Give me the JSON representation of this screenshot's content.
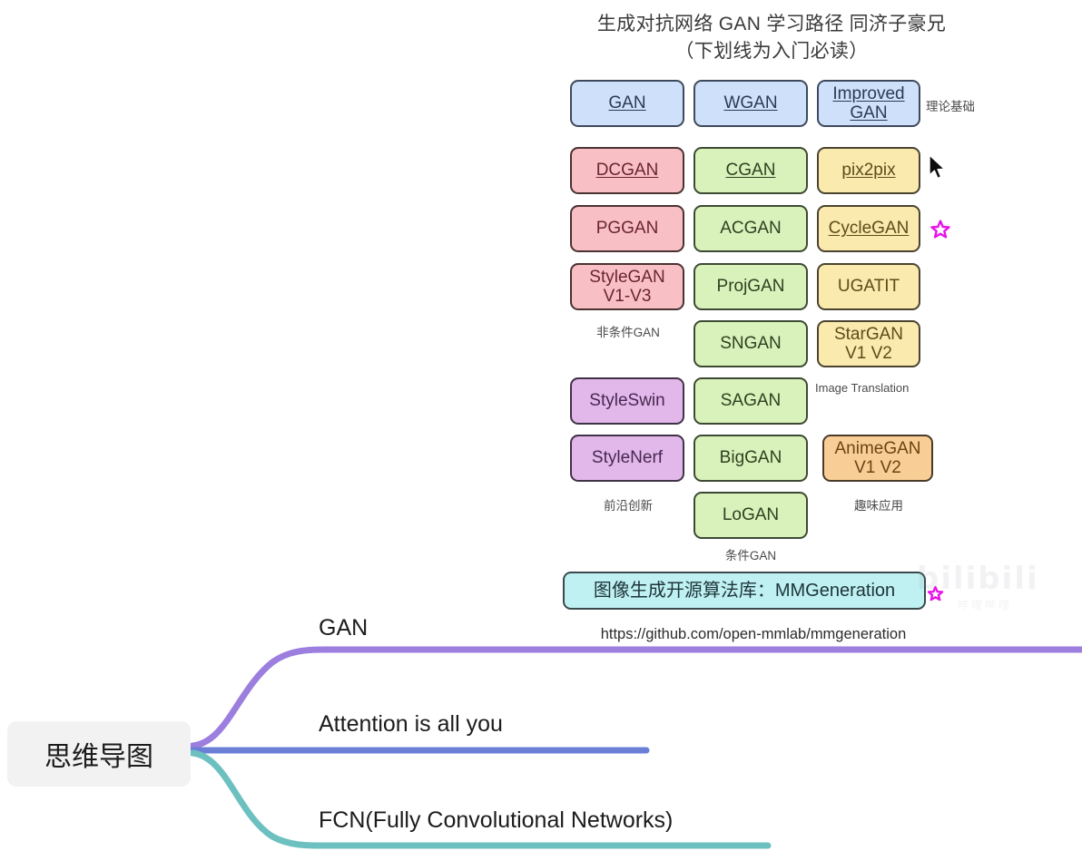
{
  "diagram": {
    "title_line1": "生成对抗网络 GAN 学习路径  同济子豪兄",
    "title_line2": "（下划线为入门必读）",
    "boxes": [
      {
        "label": "GAN",
        "color": "blue",
        "underline": true
      },
      {
        "label": "WGAN",
        "color": "blue",
        "underline": true
      },
      {
        "label": "Improved\nGAN",
        "color": "blue",
        "underline": true
      },
      {
        "label": "DCGAN",
        "color": "pink",
        "underline": true
      },
      {
        "label": "CGAN",
        "color": "green",
        "underline": true
      },
      {
        "label": "pix2pix",
        "color": "yellow",
        "underline": true
      },
      {
        "label": "PGGAN",
        "color": "pink",
        "underline": false
      },
      {
        "label": "ACGAN",
        "color": "green",
        "underline": false
      },
      {
        "label": "CycleGAN",
        "color": "yellow",
        "underline": true
      },
      {
        "label": "StyleGAN\nV1-V3",
        "color": "pink",
        "underline": false
      },
      {
        "label": "ProjGAN",
        "color": "green",
        "underline": false
      },
      {
        "label": "UGATIT",
        "color": "yellow",
        "underline": false
      },
      {
        "label": "SNGAN",
        "color": "green",
        "underline": false
      },
      {
        "label": "StarGAN\nV1 V2",
        "color": "yellow",
        "underline": false
      },
      {
        "label": "StyleSwin",
        "color": "purple",
        "underline": false
      },
      {
        "label": "SAGAN",
        "color": "green",
        "underline": false
      },
      {
        "label": "StyleNerf",
        "color": "purple",
        "underline": false
      },
      {
        "label": "BigGAN",
        "color": "green",
        "underline": false
      },
      {
        "label": "AnimeGAN\nV1 V2",
        "color": "orange",
        "underline": false
      },
      {
        "label": "LoGAN",
        "color": "green",
        "underline": false
      }
    ],
    "box_texts": {
      "gan": "GAN",
      "wgan": "WGAN",
      "improved_gan_l1": "Improved",
      "improved_gan_l2": "GAN",
      "dcgan": "DCGAN",
      "cgan": "CGAN",
      "pix2pix": "pix2pix",
      "pggan": "PGGAN",
      "acgan": "ACGAN",
      "cyclegan": "CycleGAN",
      "stylegan_l1": "StyleGAN",
      "stylegan_l2": "V1-V3",
      "projgan": "ProjGAN",
      "ugatit": "UGATIT",
      "sngan": "SNGAN",
      "stargan_l1": "StarGAN",
      "stargan_l2": "V1 V2",
      "styleswin": "StyleSwin",
      "sagan": "SAGAN",
      "stylenerf": "StyleNerf",
      "biggan": "BigGAN",
      "animegan_l1": "AnimeGAN",
      "animegan_l2": "V1 V2",
      "logan": "LoGAN"
    },
    "category_labels": {
      "theory": "理论基础",
      "unconditional_gan": "非条件GAN",
      "image_translation": "Image Translation",
      "frontier": "前沿创新",
      "fun_applications": "趣味应用",
      "conditional_gan": "条件GAN"
    },
    "mmgeneration_box": "图像生成开源算法库：MMGeneration",
    "github_url": "https://github.com/open-mmlab/mmgeneration",
    "watermark": {
      "text": "bilibili",
      "sub": "哔哩哔哩"
    },
    "star_icon": "★",
    "cursor_icon": "mouse-pointer"
  },
  "mindmap": {
    "root_label": "思维导图",
    "branches": [
      {
        "label": "GAN",
        "color": "#9b7ede"
      },
      {
        "label": "Attention is all you",
        "color": "#6b7fd7"
      },
      {
        "label": "FCN(Fully Convolutional Networks)",
        "color": "#6cc1c0"
      }
    ],
    "branch_labels": {
      "gan": "GAN",
      "attention": "Attention is all you",
      "fcn": "FCN(Fully Convolutional Networks)"
    }
  },
  "colors": {
    "branch_top": "#9b7ede",
    "branch_mid": "#6b7fd7",
    "branch_bottom": "#6cc1c0",
    "box_blue": "#cfe0fa",
    "box_pink": "#f8c0c4",
    "box_green": "#d9f2bb",
    "box_yellow": "#fbeaae",
    "box_purple": "#e2b8ea",
    "box_orange": "#f9ce96",
    "box_cyan": "#bff0f2",
    "star": "#e813e8",
    "root_bg": "#f2f2f2"
  }
}
